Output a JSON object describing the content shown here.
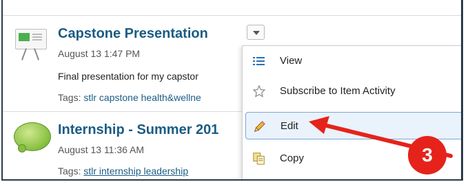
{
  "items": [
    {
      "title": "Capstone Presentation",
      "date": "August 13 1:47 PM",
      "description": "Final presentation for my capstor",
      "tags_label": "Tags:",
      "tags": "stlr capstone health&wellne",
      "icon": "presentation-icon"
    },
    {
      "title": "Internship - Summer 201",
      "date": "August 13 11:36 AM",
      "tags_label": "Tags:",
      "tags": "stlr internship leadership",
      "icon": "speech-bubble-icon"
    }
  ],
  "menu": {
    "items": [
      {
        "label": "View",
        "icon": "list-icon"
      },
      {
        "label": "Subscribe to Item Activity",
        "icon": "star-icon"
      },
      {
        "label": "Edit",
        "icon": "pencil-icon",
        "highlighted": true
      },
      {
        "label": "Copy",
        "icon": "copy-icon"
      }
    ]
  },
  "annotation": {
    "step": "3",
    "color": "#e5231b"
  },
  "colors": {
    "link": "#1a5c85",
    "highlight": "#eaf2fb"
  }
}
